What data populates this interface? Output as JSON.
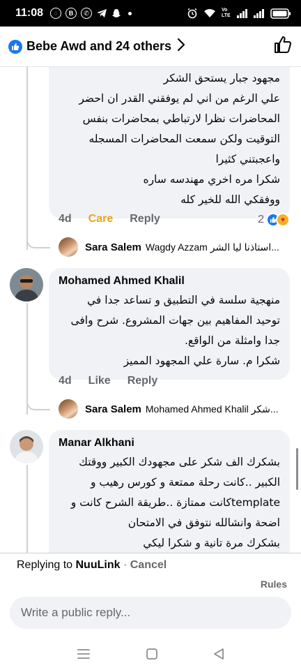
{
  "status_bar": {
    "time": "11:08",
    "network_label": "Vo LTE"
  },
  "header": {
    "title": "Bebe Awd and 24 others"
  },
  "comments": [
    {
      "lines": [
        "مجهود جبار يستحق الشكر",
        "علي الرغم من اني لم يوفقني القدر ان احضر",
        "المحاضرات نظرا لارتباطي بمحاضرات بنفس",
        "التوقيت ولكن سمعت المحاضرات المسجله",
        "واعجبتني كثيرا",
        "شكرا مره اخري مهندسه ساره",
        "ووفقكي الله للخير كله"
      ],
      "time": "4d",
      "actions": [
        "Care",
        "Reply"
      ],
      "reaction_count": "2",
      "reply_preview": {
        "name": "Sara Salem",
        "text": "Wagdy Azzam استاذنا ليا الشر..."
      }
    },
    {
      "author": "Mohamed Ahmed Khalil",
      "lines": [
        "منهجية سلسة في التطبيق و تساعد جدا في",
        "توحيد المفاهيم بين جهات المشروع. شرح وافى",
        "جدا وامثلة من الواقع.",
        "شكرا م. سارة علي المجهود المميز"
      ],
      "time": "4d",
      "actions": [
        "Like",
        "Reply"
      ],
      "reply_preview": {
        "name": "Sara Salem",
        "text": "Mohamed Ahmed Khalil شكر..."
      }
    },
    {
      "author": "Manar Alkhani",
      "lines": [
        "بشكرك الف شكر على مجهودك الكبير ووقتك",
        "الكبير ..كانت رحلة ممتعة و كورس رهيب و",
        "templateكانت ممتازة ..طريقة الشرح كانت و",
        "اضحة وانشالله نتوفق في الامتحان",
        "بشكرك مرة تانية و شكرا ليكي"
      ]
    }
  ],
  "reply_bar": {
    "replying_prefix": "Replying to",
    "replying_name": "NuuLink",
    "separator": "·",
    "cancel_label": "Cancel",
    "rules_label": "Rules",
    "input_placeholder": "Write a public reply..."
  },
  "colors": {
    "accent": "#1877f2",
    "care": "#e8a617",
    "secondary_text": "#65676b",
    "bubble_bg": "#f0f2f5"
  },
  "icons": [
    "like-badge-icon",
    "chevron-right-icon",
    "thumbs-up-icon",
    "care-reaction-icon",
    "menu-nav-icon",
    "home-nav-icon",
    "back-nav-icon"
  ]
}
